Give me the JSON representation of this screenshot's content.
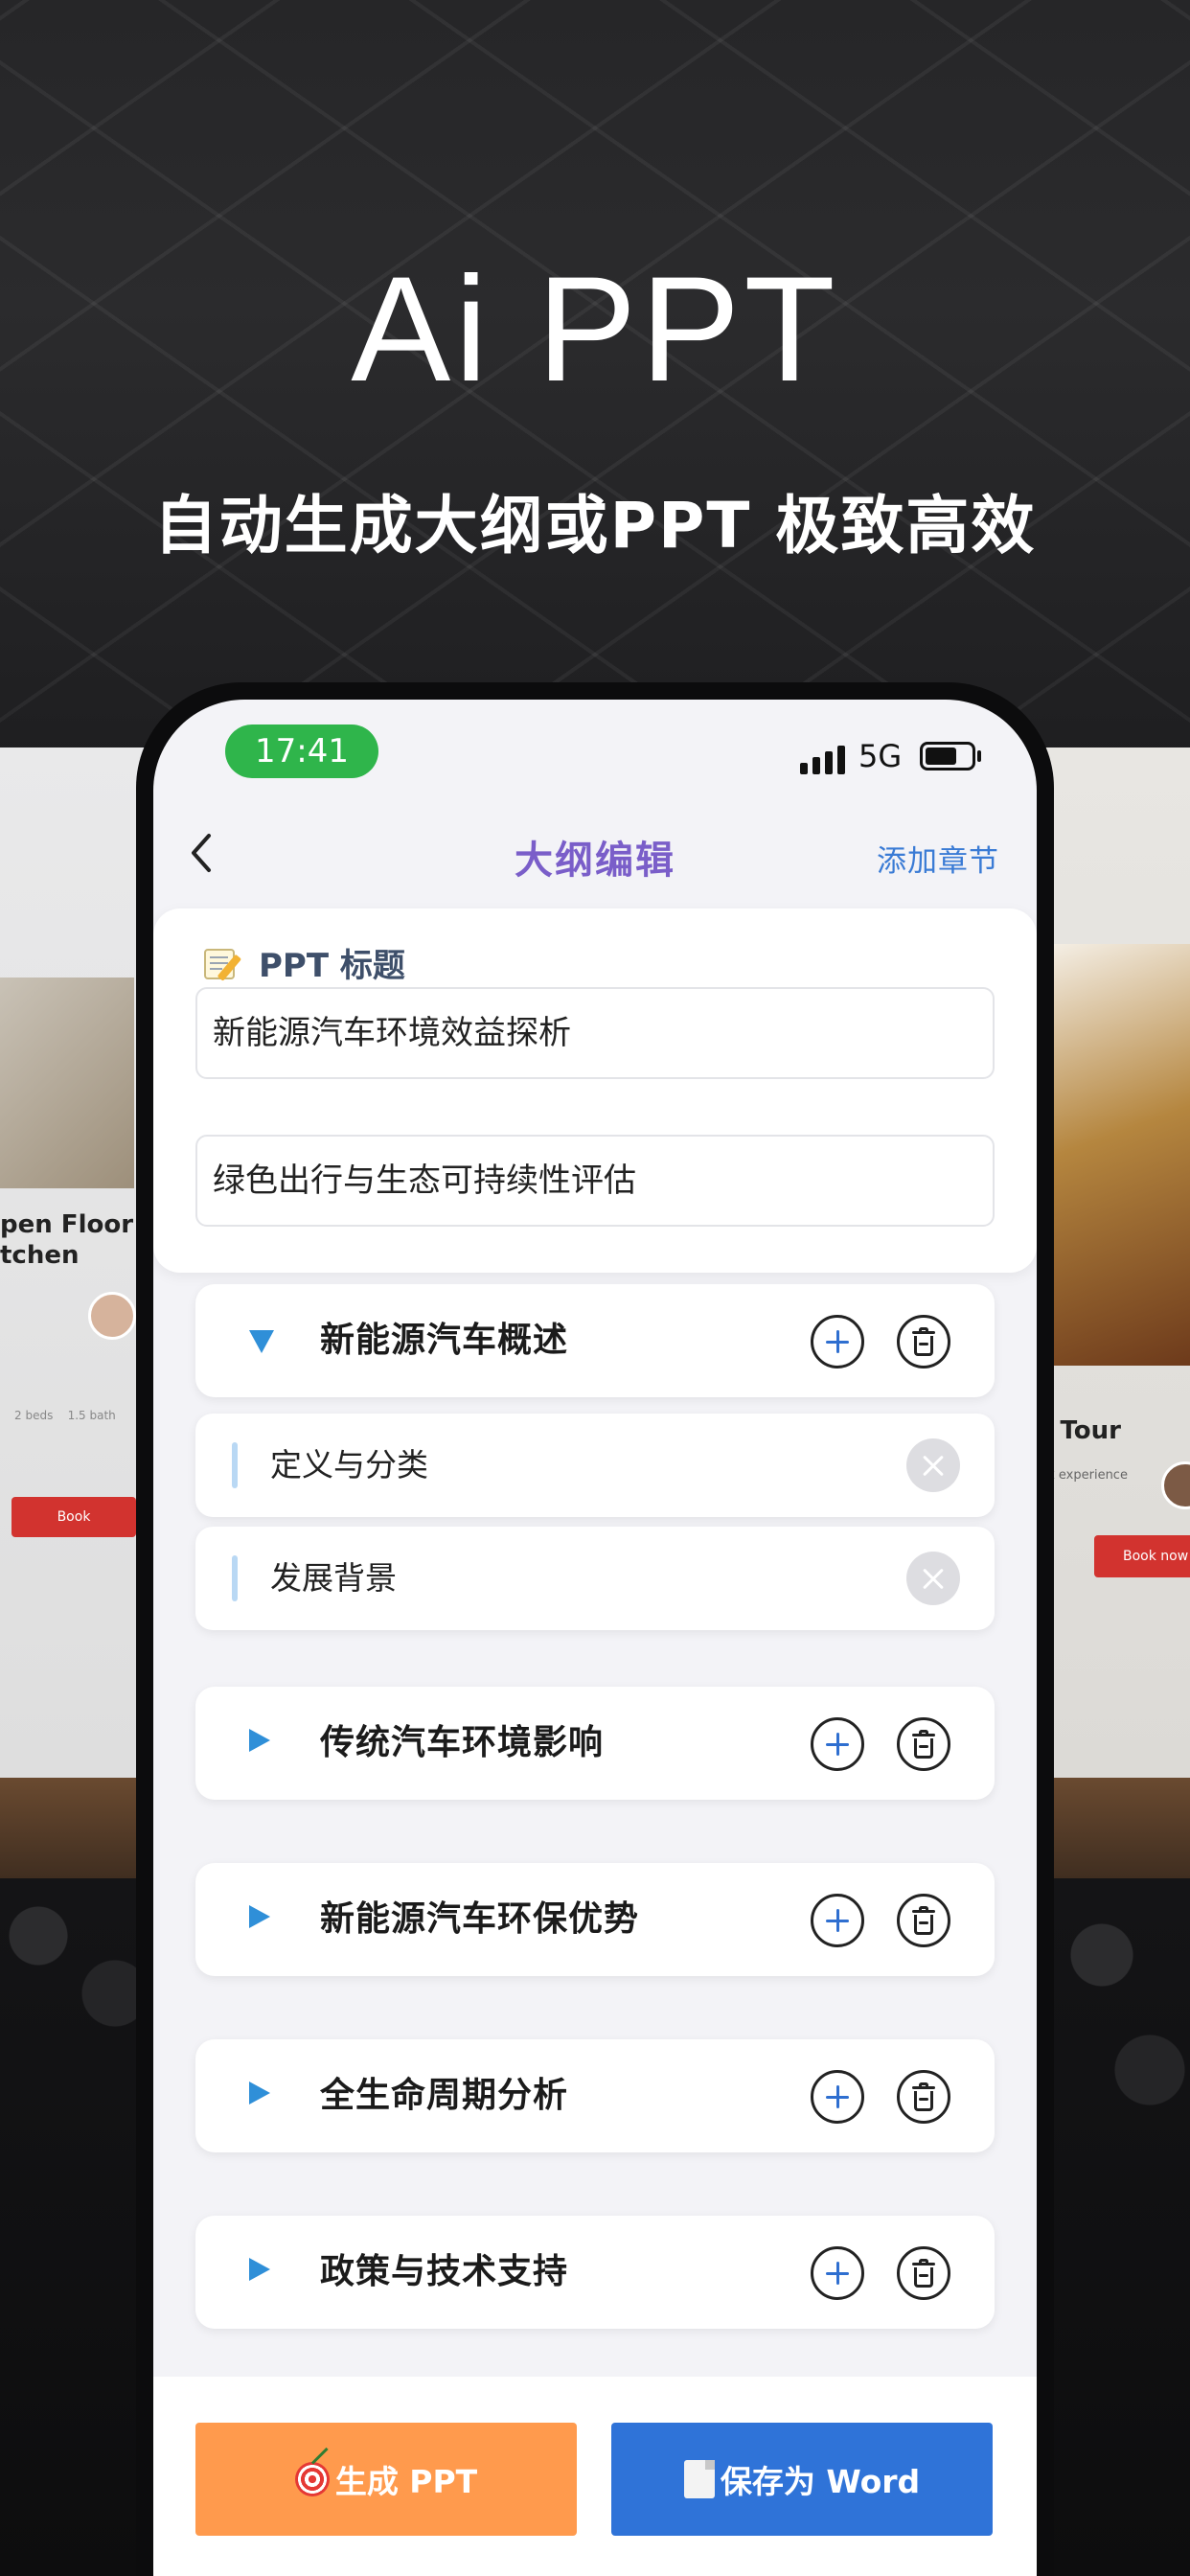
{
  "hero": {
    "title": "Ai PPT",
    "subtitle": "自动生成大纲或PPT 极致高效"
  },
  "status_bar": {
    "time": "17:41",
    "network": "5G",
    "time_pill_color": "#2fb54b"
  },
  "nav": {
    "title": "大纲编辑",
    "action": "添加章节",
    "back_icon": "chevron-left-icon"
  },
  "title_card": {
    "heading_emoji": "memo-icon",
    "heading": "PPT 标题",
    "title_value": "新能源汽车环境效益探析",
    "subtitle_value": "绿色出行与生态可持续性评估"
  },
  "chapters": [
    {
      "label": "新能源汽车概述",
      "expanded": true,
      "subsections": [
        "定义与分类",
        "发展背景"
      ]
    },
    {
      "label": "传统汽车环境影响",
      "expanded": false
    },
    {
      "label": "新能源汽车环保优势",
      "expanded": false
    },
    {
      "label": "全生命周期分析",
      "expanded": false
    },
    {
      "label": "政策与技术支持",
      "expanded": false
    }
  ],
  "bottom": {
    "generate_label": "生成 PPT",
    "generate_icon": "dart-target-icon",
    "word_label": "保存为 Word",
    "word_icon": "document-icon"
  },
  "background_decor": {
    "left_card_title": "pen Floor\ntchen",
    "left_card_meta": "2 beds    1.5 bath",
    "left_card_button": "Book",
    "right_card_title": "t Tour",
    "right_card_sub": "nk experience",
    "right_card_button": "Book now"
  },
  "colors": {
    "accent_purple": "#7a5ec9",
    "accent_blue": "#3a7bd5",
    "chevron_blue": "#2f8fd8",
    "generate_orange": "#ff9a4d",
    "word_blue": "#2f73d8"
  }
}
